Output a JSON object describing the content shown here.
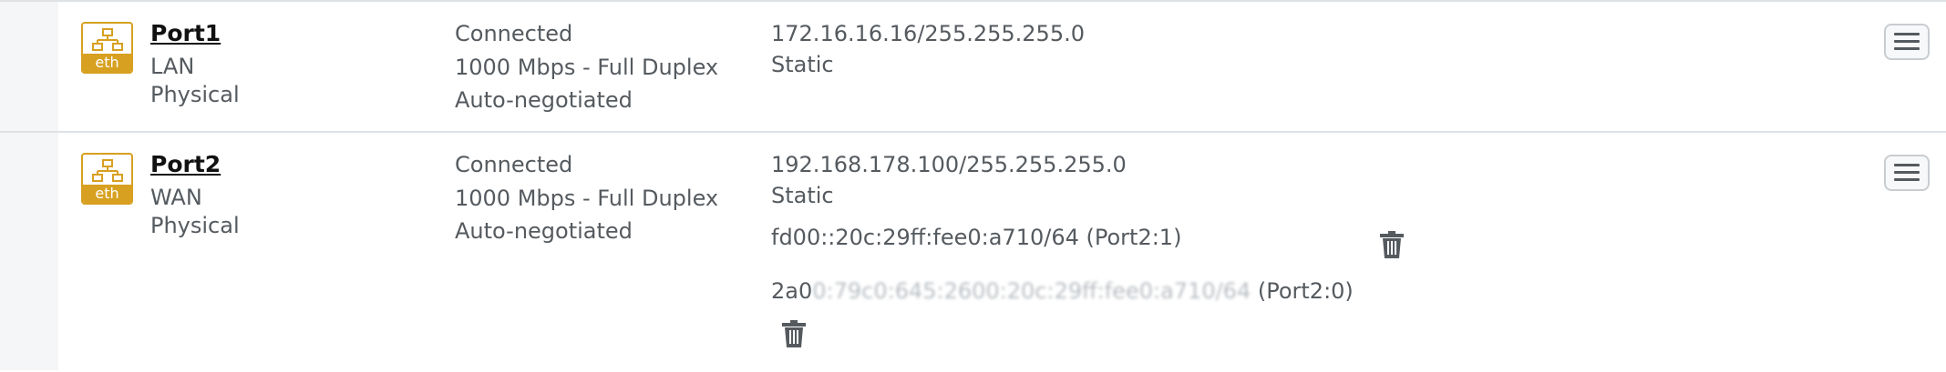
{
  "interfaces": [
    {
      "name": "Port1",
      "zone": "LAN",
      "type": "Physical",
      "icon": "ethernet-icon",
      "icon_label": "eth",
      "connection_status": "Connected",
      "speed": "1000 Mbps - Full Duplex",
      "negotiation": "Auto-negotiated",
      "ipv4": "172.16.16.16/255.255.255.0",
      "ipv4_mode": "Static"
    },
    {
      "name": "Port2",
      "zone": "WAN",
      "type": "Physical",
      "icon": "ethernet-icon",
      "icon_label": "eth",
      "connection_status": "Connected",
      "speed": "1000 Mbps - Full Duplex",
      "negotiation": "Auto-negotiated",
      "ipv4": "192.168.178.100/255.255.255.0",
      "ipv4_mode": "Static",
      "ipv6_addresses": [
        {
          "address": "fd00::20c:29ff:fee0:a710/64",
          "alias": "(Port2:1)"
        },
        {
          "address_visible": "2a0",
          "address_redacted": "0:79c0:645:2600:20c:29ff:fee0:a710/64",
          "alias": "(Port2:0)"
        }
      ]
    }
  ],
  "colors": {
    "icon_accent": "#d7a020",
    "text": "#555a5f",
    "border": "#dfe2e5"
  }
}
